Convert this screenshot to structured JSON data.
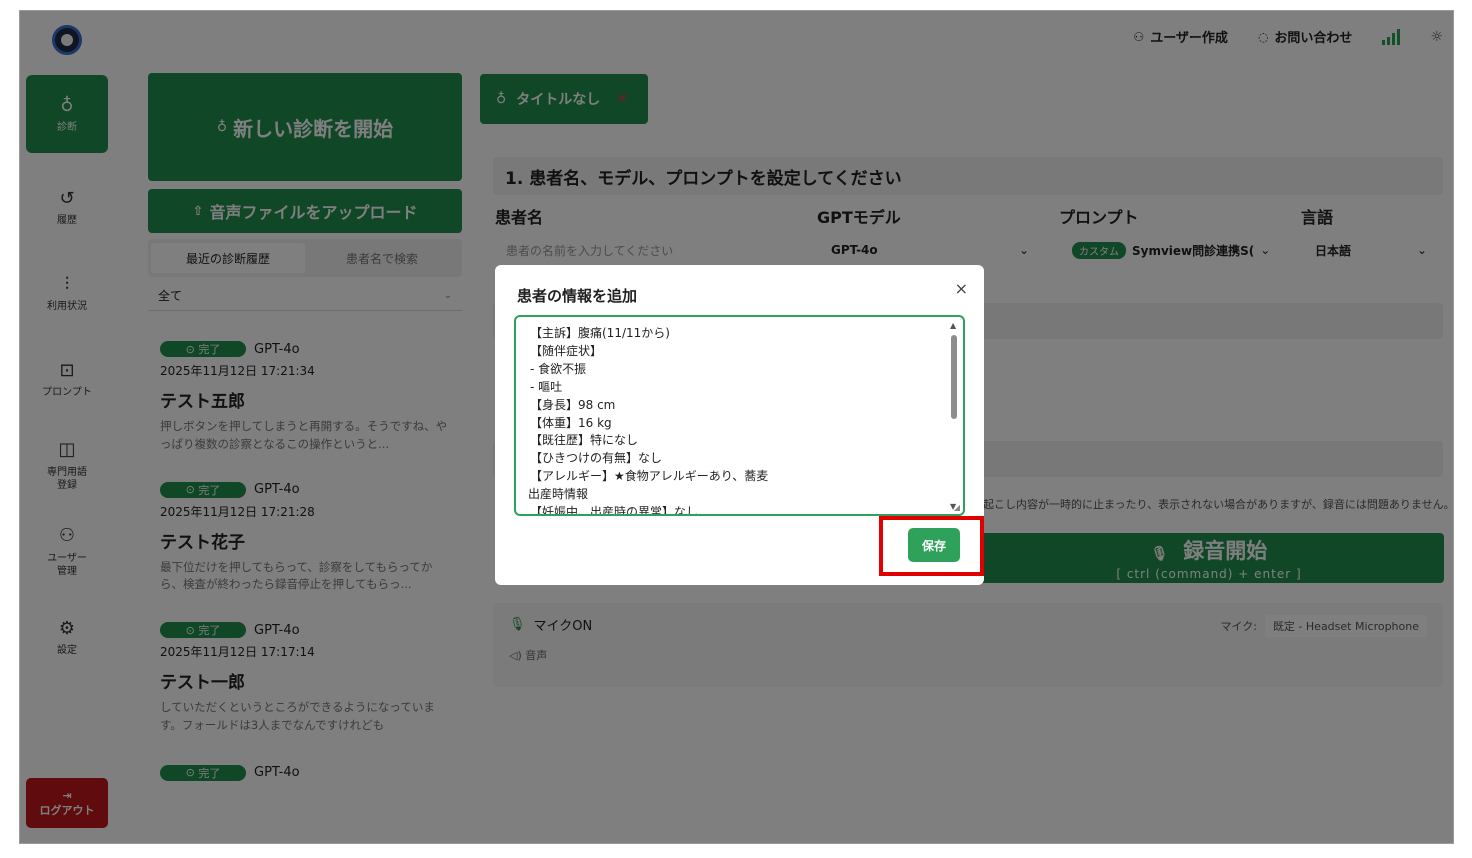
{
  "header": {
    "create_user": "ユーザー作成",
    "contact": "お問い合わせ"
  },
  "nav": {
    "diagnosis": "診断",
    "history": "履歴",
    "usage": "利用状況",
    "prompt": "プロンプト",
    "terms_line1": "専門用語",
    "terms_line2": "登録",
    "user_line1": "ユーザー",
    "user_line2": "管理",
    "settings": "設定",
    "logout": "ログアウト"
  },
  "history": {
    "new_diagnosis": "新しい診断を開始",
    "upload_audio": "音声ファイルをアップロード",
    "tab_recent": "最近の診断履歴",
    "tab_search": "患者名で検索",
    "filter_value": "全て",
    "entries": [
      {
        "status": "完了",
        "model": "GPT-4o",
        "date": "2025年11月12日 17:21:34",
        "name": "テスト五郎",
        "snippet": "押しボタンを押してしまうと再開する。そうですね、やっぱり複数の診察となるこの操作というと..."
      },
      {
        "status": "完了",
        "model": "GPT-4o",
        "date": "2025年11月12日 17:21:28",
        "name": "テスト花子",
        "snippet": "最下位だけを押してもらって、診察をしてもらってから、検査が終わったら録音停止を押してもらっ..."
      },
      {
        "status": "完了",
        "model": "GPT-4o",
        "date": "2025年11月12日 17:17:14",
        "name": "テスト一郎",
        "snippet": "していただくというところができるようになっています。フォールドは3人までなんですけれども"
      },
      {
        "status": "完了",
        "model": "GPT-4o"
      }
    ]
  },
  "main": {
    "title_chip": "タイトルなし",
    "step1": "1. 患者名、モデル、プロンプトを設定してください",
    "label_patient": "患者名",
    "label_model": "GPTモデル",
    "label_prompt": "プロンプト",
    "label_language": "言語",
    "patient_placeholder": "患者の名前を入力してください",
    "model_value": "GPT-4o",
    "prompt_tag": "カスタム",
    "prompt_value": "Symview問診連携S(",
    "language_value": "日本語",
    "warning": "起こし内容が一時的に止まったり、表示されない場合がありますが、録音には問題ありません。",
    "record_label": "録音開始",
    "record_hint": "[ ctrl (command) + enter ]",
    "mic_on": "マイクON",
    "sound": "音声",
    "mic_label": "マイク:",
    "mic_device": "既定 - Headset Microphone"
  },
  "modal": {
    "title": "患者の情報を追加",
    "close": "×",
    "lines": [
      "【主訴】腹痛(11/11から)",
      "【随伴症状】",
      "- 食欲不振",
      "- 嘔吐",
      "【身長】98 cm",
      "【体重】16 kg",
      "【既往歴】特になし",
      "【ひきつけの有無】なし",
      "【アレルギー】★食物アレルギーあり、蕎麦",
      "出産時情報",
      "【妊娠中、出産時の異常】なし"
    ],
    "save": "保存"
  },
  "colors": {
    "brand_green": "#1f8f4e",
    "save_green": "#2ea15a",
    "highlight_red": "#e00000",
    "logout_red": "#c0161b"
  }
}
